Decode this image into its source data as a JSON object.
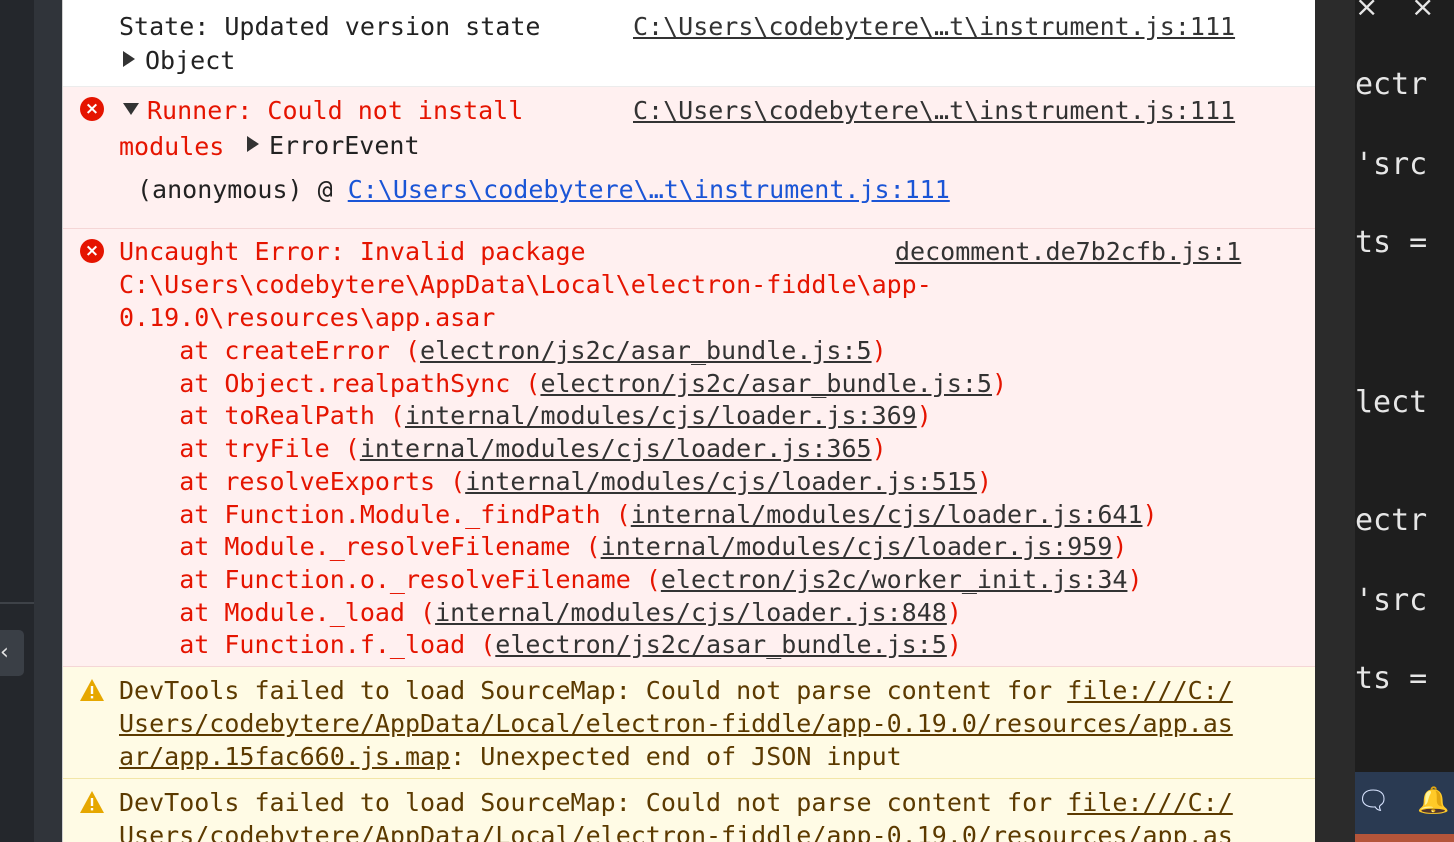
{
  "left_rail": {
    "collapse_glyph": "‹"
  },
  "console": {
    "log_message": {
      "text": "State: Updated version state",
      "source": "C:\\Users\\codebytere\\…t\\instrument.js:111",
      "object_label": "Object"
    },
    "error1": {
      "line1": "Runner: Could not install",
      "line2": "modules",
      "event_label": "ErrorEvent",
      "source": "C:\\Users\\codebytere\\…t\\instrument.js:111",
      "trace_prefix": "(anonymous) @ ",
      "trace_link": "C:\\Users\\codebytere\\…t\\instrument.js:111"
    },
    "error2": {
      "line1": "Uncaught Error: Invalid package",
      "line2": "C:\\Users\\codebytere\\AppData\\Local\\electron-fiddle\\app-",
      "line3": "0.19.0\\resources\\app.asar",
      "source": "decomment.de7b2cfb.js:1",
      "stack": [
        {
          "fn": "    at createError (",
          "loc": "electron/js2c/asar_bundle.js:5",
          "end": ")"
        },
        {
          "fn": "    at Object.realpathSync (",
          "loc": "electron/js2c/asar_bundle.js:5",
          "end": ")"
        },
        {
          "fn": "    at toRealPath (",
          "loc": "internal/modules/cjs/loader.js:369",
          "end": ")"
        },
        {
          "fn": "    at tryFile (",
          "loc": "internal/modules/cjs/loader.js:365",
          "end": ")"
        },
        {
          "fn": "    at resolveExports (",
          "loc": "internal/modules/cjs/loader.js:515",
          "end": ")"
        },
        {
          "fn": "    at Function.Module._findPath (",
          "loc": "internal/modules/cjs/loader.js:641",
          "end": ")"
        },
        {
          "fn": "    at Module._resolveFilename (",
          "loc": "internal/modules/cjs/loader.js:959",
          "end": ")"
        },
        {
          "fn": "    at Function.o._resolveFilename (",
          "loc": "electron/js2c/worker_init.js:34",
          "end": ")"
        },
        {
          "fn": "    at Module._load (",
          "loc": "internal/modules/cjs/loader.js:848",
          "end": ")"
        },
        {
          "fn": "    at Function.f._load (",
          "loc": "electron/js2c/asar_bundle.js:5",
          "end": ")"
        }
      ]
    },
    "warning1": {
      "prefix": "DevTools failed to load SourceMap: Could not parse content for ",
      "link_part1": "file:///C:/",
      "link_part2": "Users/codebytere/AppData/Local/electron-fiddle/app-0.19.0/resources/app.as",
      "link_part3": "ar/app.15fac660.js.map",
      "suffix": ": Unexpected end of JSON input"
    },
    "warning2": {
      "prefix": "DevTools failed to load SourceMap: Could not parse content for ",
      "link_part1": "file:///C:/",
      "link_part2": "Users/codebytere/AppData/Local/electron-fiddle/app-0.19.0/resources/app.as"
    }
  },
  "editor": {
    "lines": [
      "ectr",
      "'src",
      "ts =",
      "lect",
      "ectr",
      "'src",
      "ts ="
    ]
  },
  "colors": {
    "error_red": "#e51400",
    "error_bg": "#fff0f0",
    "warning_bg": "#fffbe5",
    "link_blue": "#1a55d6"
  }
}
